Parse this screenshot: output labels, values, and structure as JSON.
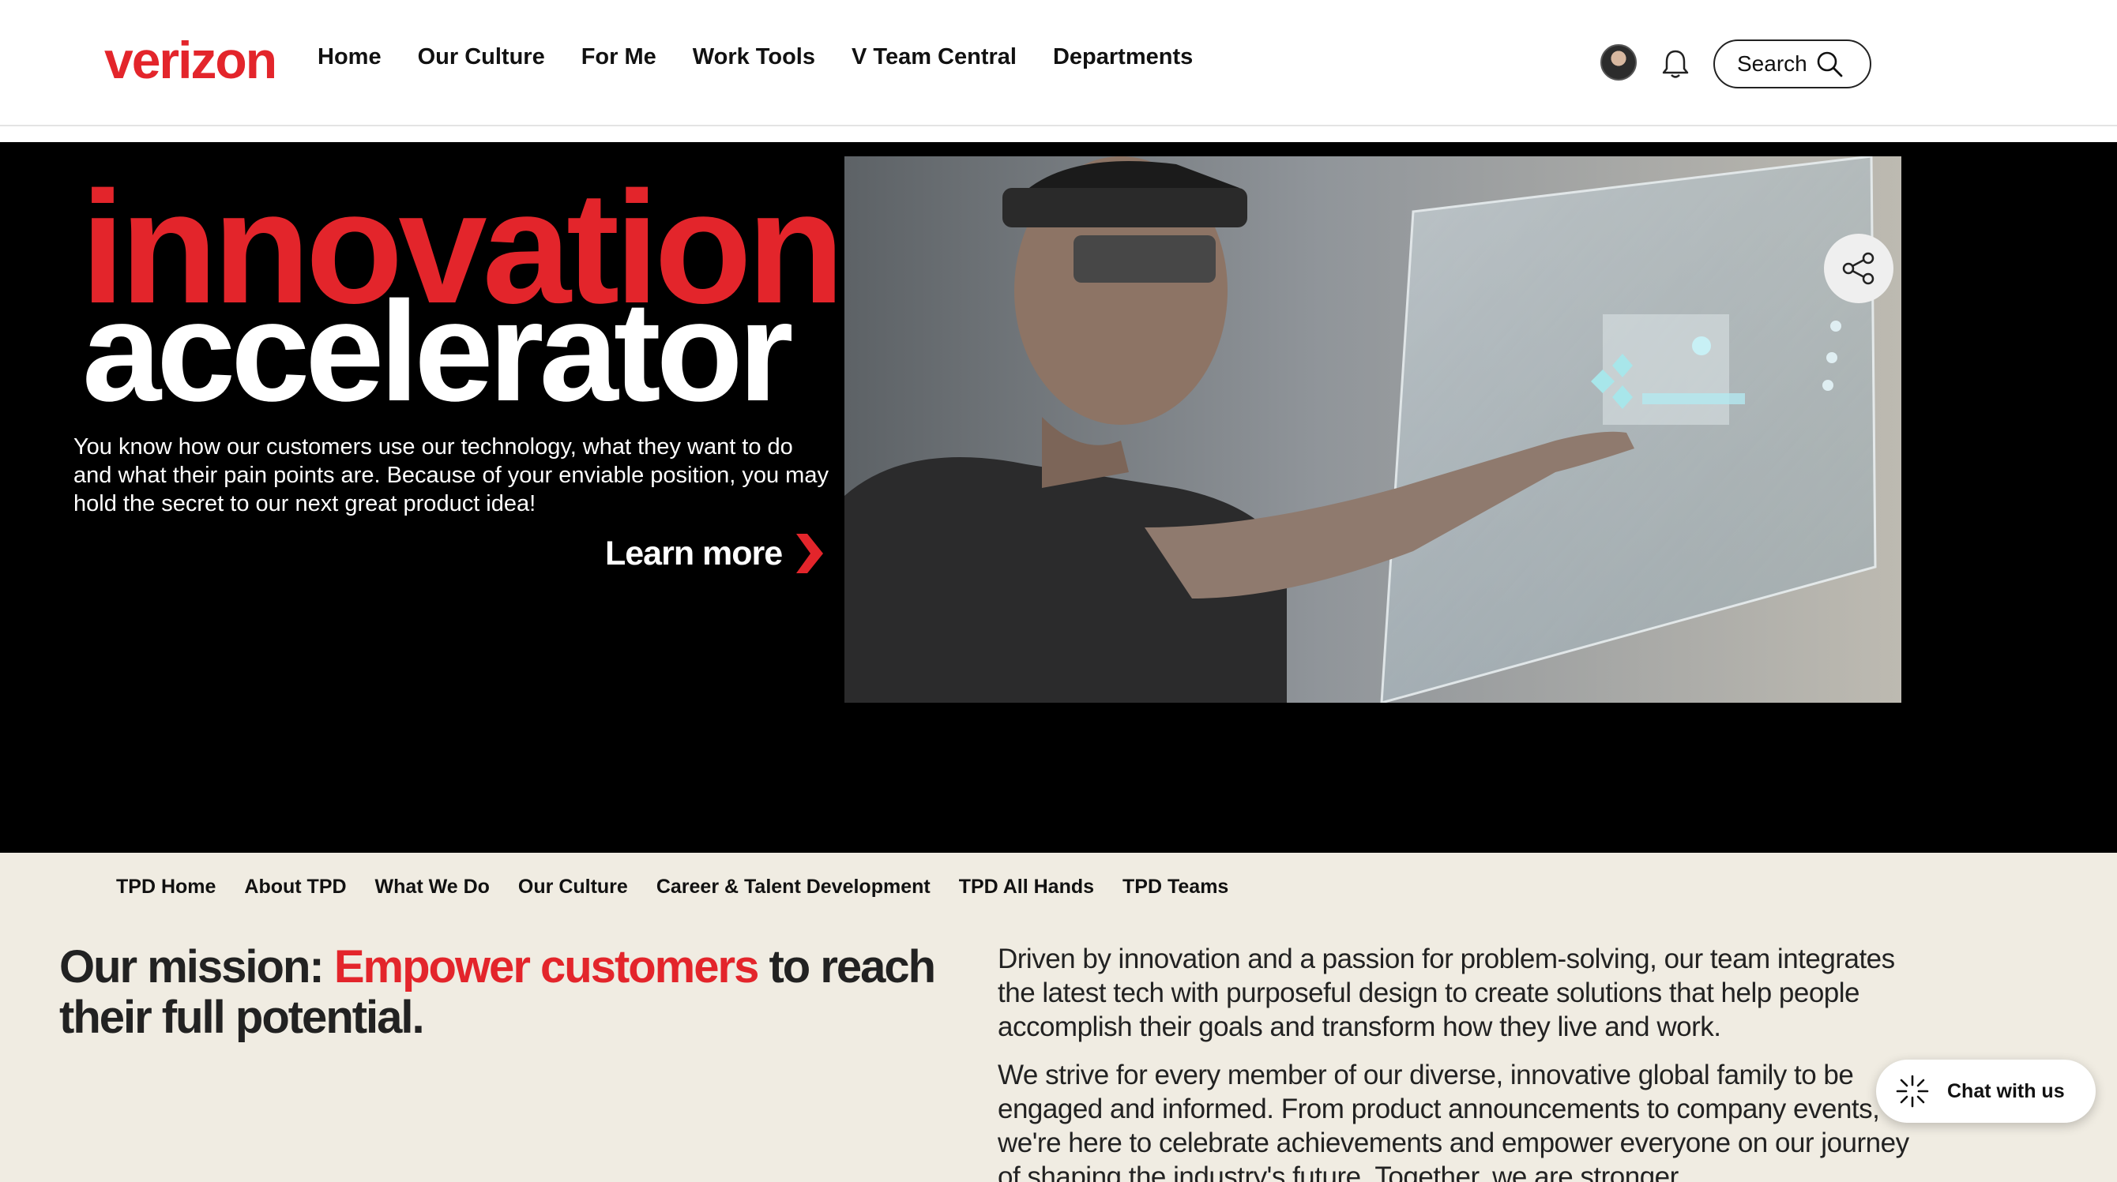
{
  "header": {
    "logo": "verizon",
    "nav": [
      "Home",
      "Our Culture",
      "For Me",
      "Work Tools",
      "V Team Central",
      "Departments"
    ],
    "search_label": "Search"
  },
  "hero": {
    "title_line1": "innovation",
    "title_line2": "accelerator",
    "body": "You know how our customers use our technology, what they want to do and what their pain points are. Because of your enviable position, you may hold the secret to our next great product idea!",
    "cta": "Learn more"
  },
  "subnav": [
    "TPD Home",
    "About TPD",
    "What We Do",
    "Our Culture",
    "Career & Talent Development",
    "TPD All Hands",
    "TPD Teams"
  ],
  "mission": {
    "prefix": "Our mission: ",
    "accent": "Empower customers",
    "suffix": " to reach their full potential."
  },
  "about": {
    "p1": "Driven by innovation and a passion for problem-solving, our team integrates the latest tech with purposeful design to create solutions that help people accomplish their goals and transform how they live and work.",
    "p2": "We strive for every member of our diverse, innovative global family to be engaged and informed. From product announcements to company events, we're here to celebrate achievements and empower everyone on our journey of shaping the industry's future. Together, we are stronger."
  },
  "chat": {
    "label": "Chat with us"
  },
  "colors": {
    "brand_red": "#e3252b",
    "hero_bg": "#000000",
    "section_bg": "#f0ece2"
  }
}
